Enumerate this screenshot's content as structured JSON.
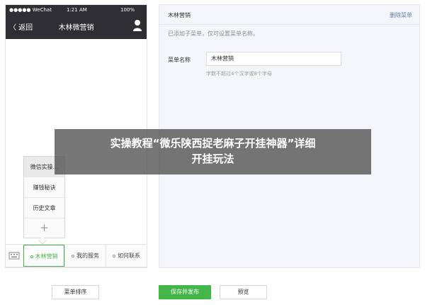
{
  "phone": {
    "statusbar": {
      "carrier": "●●●●● WeChat",
      "time": "1:21 AM",
      "battery": "100%"
    },
    "navbar": {
      "back_label": "〈 返回",
      "title": "木林微营销",
      "user_icon": "user-icon"
    },
    "submenu": {
      "items": [
        {
          "label": "微信实操..."
        },
        {
          "label": "赚钱秘诀"
        },
        {
          "label": "历史文章"
        }
      ],
      "add_label": "+"
    },
    "tabbar": {
      "keyboard_icon": "keyboard-icon",
      "tabs": [
        {
          "label": "木林营销",
          "active": true
        },
        {
          "label": "我的服务",
          "active": false
        },
        {
          "label": "如何联系",
          "active": false
        }
      ]
    }
  },
  "editor": {
    "menu_title": "木林营销",
    "delete_label": "删除菜单",
    "note": "已添加子菜单，仅可设置菜单名称。",
    "name_label": "菜单名称",
    "name_value": "木林营销",
    "name_hint": "字数不超过4个汉字或8个字母"
  },
  "overlay": {
    "line1": "实操教程“微乐陕西捉老麻子开挂神器”详细",
    "line2": "开挂玩法"
  },
  "buttons": {
    "sort_label": "菜单排序",
    "save_label": "保存并发布",
    "preview_label": "预览"
  },
  "colors": {
    "accent": "#44b549",
    "navbar": "#2f2f33",
    "link": "#607fa6"
  }
}
